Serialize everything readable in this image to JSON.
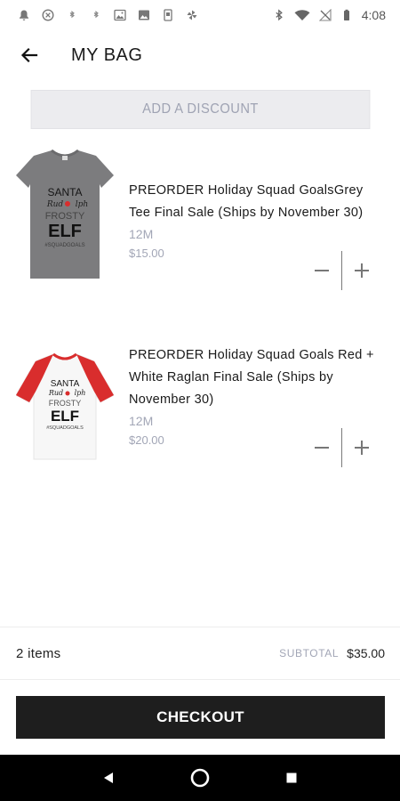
{
  "status_bar": {
    "time": "4:08",
    "left_icons": [
      "notification-bell-icon",
      "hidden-circle-icon",
      "bluetooth-small-icon",
      "bluetooth-small-icon",
      "photo-icon",
      "image-icon",
      "phone-app-icon",
      "pinwheel-icon"
    ],
    "right_icons": [
      "bluetooth-icon",
      "wifi-icon",
      "no-signal-icon",
      "battery-icon"
    ]
  },
  "header": {
    "back_icon": "arrow-left-icon",
    "title": "MY BAG"
  },
  "discount": {
    "label": "ADD A DISCOUNT"
  },
  "items": [
    {
      "title": "PREORDER Holiday Squad GoalsGrey Tee Final Sale (Ships by November 30)",
      "size": "12M",
      "price": "$15.00",
      "image": "grey-tee-image",
      "shirt_text": [
        "SANTA",
        "FROSTY",
        "ELF",
        "#SQUADGOALS"
      ]
    },
    {
      "title": "PREORDER Holiday Squad Goals Red + White Raglan Final Sale (Ships by November 30)",
      "size": "12M",
      "price": "$20.00",
      "image": "red-white-raglan-image",
      "shirt_text": [
        "SANTA",
        "FROSTY",
        "ELF",
        "#SQUADGOALS"
      ]
    }
  ],
  "summary": {
    "items_count": "2 items",
    "subtotal_label": "SUBTOTAL",
    "subtotal_value": "$35.00"
  },
  "checkout": {
    "label": "CHECKOUT"
  },
  "colors": {
    "accent_dark": "#1e1e1e",
    "muted_text": "#a2a6b6",
    "discount_bg": "#ececef",
    "raglan_red": "#d92d2d",
    "tee_grey": "#7c7c7e"
  },
  "nav_bar": {
    "buttons": [
      "back-triangle-icon",
      "home-circle-icon",
      "recents-square-icon"
    ]
  }
}
